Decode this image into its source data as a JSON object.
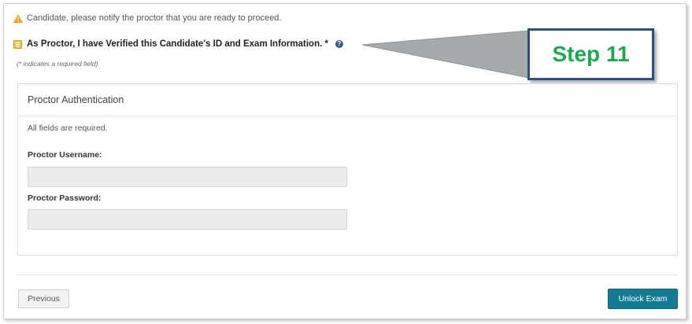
{
  "notice": {
    "icon": "warning-icon",
    "text": "Candidate, please notify the proctor that you are ready to proceed."
  },
  "verification": {
    "checkbox_checked": true,
    "label": "As Proctor, I have Verified this Candidate's ID and Exam Information. *",
    "help_icon": "question-circle-icon",
    "help_glyph": "?"
  },
  "required_note": "(* indicates a required field)",
  "callout": {
    "label": "Step 11"
  },
  "panel": {
    "title": "Proctor Authentication",
    "all_required": "All fields are required.",
    "username_label": "Proctor Username:",
    "username_value": "",
    "password_label": "Proctor Password:",
    "password_value": ""
  },
  "buttons": {
    "previous": "Previous",
    "unlock": "Unlock Exam"
  },
  "colors": {
    "accent_button": "#137b94",
    "callout_text": "#1fa84f",
    "callout_border": "#2f4f7a",
    "warning": "#e8a317"
  }
}
